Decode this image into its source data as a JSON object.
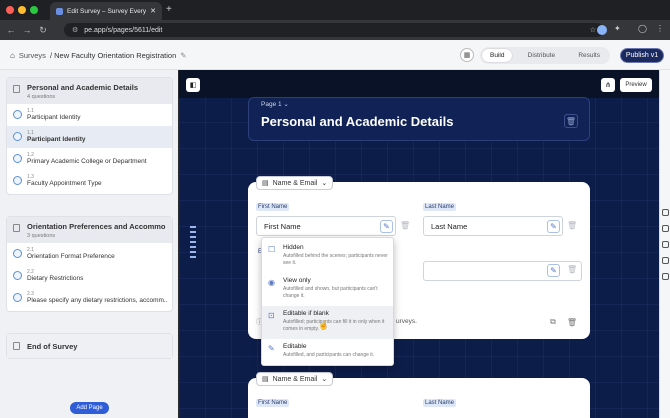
{
  "browser": {
    "tab_title": "Edit Survey – Survey Everywh",
    "url": "pe.app/s/pages/5611/edit",
    "new_tab_label": "+"
  },
  "header": {
    "breadcrumb_root": "Surveys",
    "breadcrumb_title": "/ New Faculty Orientation Registration",
    "tabs": [
      "Build",
      "Distribute",
      "Results"
    ],
    "active_tab": "Build",
    "publish_label": "Publish v1"
  },
  "sidebar": {
    "sections": [
      {
        "title": "Personal and Academic Details",
        "count": "4 questions",
        "questions": [
          {
            "num": "1.1",
            "label": "Participant Identity",
            "bold": false
          },
          {
            "num": "1.1",
            "label": "Participant Identity",
            "bold": true
          },
          {
            "num": "1.2",
            "label": "Primary Academic College or Department",
            "bold": false
          },
          {
            "num": "1.3",
            "label": "Faculty Appointment Type",
            "bold": false
          }
        ]
      },
      {
        "title": "Orientation Preferences and Accommo...",
        "count": "3 questions",
        "questions": [
          {
            "num": "2.1",
            "label": "Orientation Format Preference",
            "bold": false
          },
          {
            "num": "2.2",
            "label": "Dietary Restrictions",
            "bold": false
          },
          {
            "num": "2.3",
            "label": "Please specify any dietary restrictions, accomm...",
            "bold": false
          }
        ]
      },
      {
        "title": "End of Survey",
        "count": "",
        "questions": []
      }
    ],
    "add_page_label": "Add Page"
  },
  "canvas": {
    "preview_label": "Preview",
    "page_label": "Page 1",
    "page_title": "Personal and Academic Details",
    "card1": {
      "type_label": "Name & Email",
      "first_label": "First Name",
      "first_value": "First Name",
      "last_label": "Last Name",
      "last_value": "Last Name",
      "hidden_label": "E",
      "footer_text": "urveys."
    },
    "card2": {
      "type_label": "Name & Email",
      "first_label": "First Name",
      "last_label": "Last Name"
    },
    "menu": [
      {
        "title": "Hidden",
        "desc": "Autofilled behind the scenes; participants never see it.",
        "icon": "☐",
        "highlight": false
      },
      {
        "title": "View only",
        "desc": "Autofilled and shown, but participants can't change it.",
        "icon": "◉",
        "highlight": false
      },
      {
        "title": "Editable if blank",
        "desc": "Autofilled; participants can fill it in only when it comes in empty.",
        "icon": "🔒",
        "highlight": true
      },
      {
        "title": "Editable",
        "desc": "Autofilled, and participants can change it.",
        "icon": "✎",
        "highlight": false
      }
    ]
  },
  "colors": {
    "canvas_bg": "#0d1d4a",
    "publish_bg": "#1a2a5e",
    "accent": "#2f5dd7"
  }
}
